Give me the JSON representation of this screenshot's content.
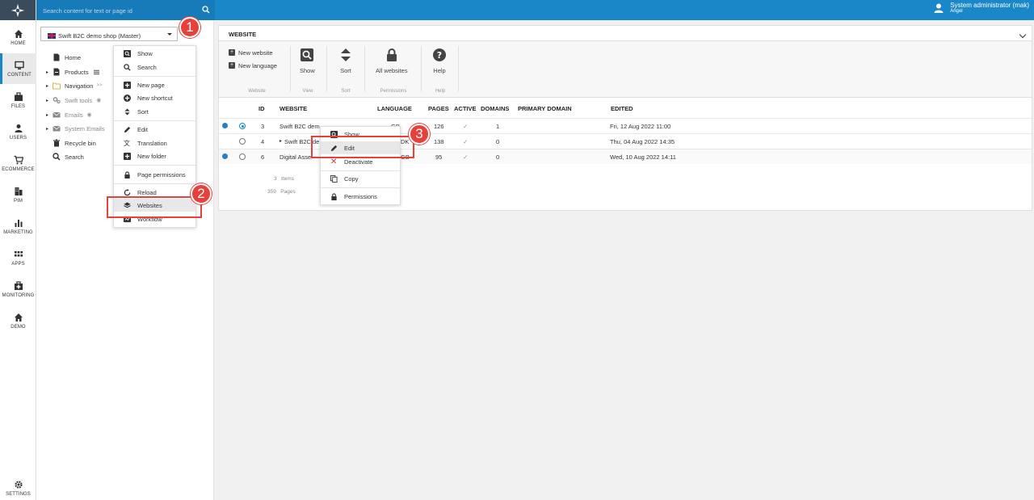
{
  "nav": {
    "items": [
      {
        "id": "home",
        "label": "HOME"
      },
      {
        "id": "content",
        "label": "CONTENT"
      },
      {
        "id": "files",
        "label": "FILES"
      },
      {
        "id": "users",
        "label": "USERS"
      },
      {
        "id": "ecommerce",
        "label": "ECOMMERCE"
      },
      {
        "id": "pim",
        "label": "PIM"
      },
      {
        "id": "marketing",
        "label": "MARKETING"
      },
      {
        "id": "apps",
        "label": "APPS"
      },
      {
        "id": "monitoring",
        "label": "MONITORING"
      },
      {
        "id": "demo",
        "label": "DEMO"
      }
    ],
    "settings_label": "SETTINGS",
    "active": "content"
  },
  "topbar": {
    "search_placeholder": "Search content for text or page id",
    "user_name": "System administrator (mak)",
    "user_sub": "Angel"
  },
  "tree": {
    "shop_selector": "Swift B2C demo shop (Master)",
    "items": [
      {
        "label": "Home"
      },
      {
        "label": "Products"
      },
      {
        "label": "Navigation"
      },
      {
        "label": "Swift tools"
      },
      {
        "label": "Emails"
      },
      {
        "label": "System Emails"
      },
      {
        "label": "Recycle bin"
      },
      {
        "label": "Search"
      }
    ]
  },
  "context_menu_tree": {
    "items": [
      "Show",
      "Search",
      "New page",
      "New shortcut",
      "Sort",
      "Edit",
      "Translation",
      "New folder",
      "Page permissions",
      "Reload",
      "Websites",
      "Workflow"
    ]
  },
  "main": {
    "tab": "WEBSITE",
    "ribbon": {
      "new_website": "New website",
      "new_language": "New language",
      "show": "Show",
      "sort": "Sort",
      "all_websites": "All websites",
      "help": "Help",
      "groups": [
        "Website",
        "View",
        "Sort",
        "Permissions",
        "Help"
      ]
    },
    "columns": [
      "ID",
      "WEBSITE",
      "LANGUAGE",
      "PAGES",
      "ACTIVE",
      "DOMAINS",
      "PRIMARY DOMAIN",
      "EDITED"
    ],
    "rows": [
      {
        "id": "3",
        "website": "Swift B2C dem",
        "language": "GB",
        "pages": "126",
        "active": "✓",
        "domains": "1",
        "edited": "Fri, 12 Aug 2022 11:00"
      },
      {
        "id": "4",
        "website": "Swift B2C de",
        "language": "DK",
        "pages": "138",
        "active": "✓",
        "domains": "0",
        "edited": "Thu, 04 Aug 2022 14:35"
      },
      {
        "id": "6",
        "website": "Digital Asse",
        "language": "GB",
        "pages": "95",
        "active": "✓",
        "domains": "0",
        "edited": "Wed, 10 Aug 2022 14:11"
      }
    ],
    "totals": {
      "items_count": "3",
      "items_label": "Items",
      "pages_count": "359",
      "pages_label": "Pages"
    }
  },
  "context_menu_row": {
    "items": [
      "Show",
      "Edit",
      "Deactivate",
      "Copy",
      "Permissions"
    ]
  },
  "callouts": [
    "1",
    "2",
    "3"
  ]
}
